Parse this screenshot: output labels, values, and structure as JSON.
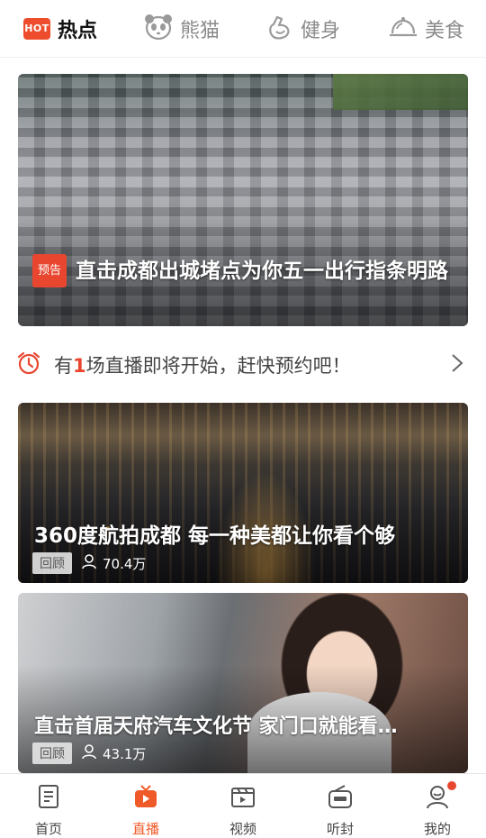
{
  "top_tabs": [
    {
      "label": "热点",
      "icon": "hot-badge",
      "badge_text": "HOT",
      "active": true
    },
    {
      "label": "熊猫",
      "icon": "panda-icon"
    },
    {
      "label": "健身",
      "icon": "fitness-icon"
    },
    {
      "label": "美食",
      "icon": "food-cloche-icon"
    }
  ],
  "feature_card": {
    "tag": "预告",
    "title": "直击成都出城堵点为你五一出行指条明路"
  },
  "notice": {
    "prefix": "有",
    "count": "1",
    "suffix": "场直播即将开始，赶快预约吧！"
  },
  "video_cards": [
    {
      "title": "360度航拍成都 每一种美都让你看个够",
      "tag": "回顾",
      "viewers": "70.4万"
    },
    {
      "title": "直击首届天府汽车文化节 家门口就能看…",
      "tag": "回顾",
      "viewers": "43.1万"
    }
  ],
  "bottom_nav": [
    {
      "label": "首页",
      "icon": "news-icon"
    },
    {
      "label": "直播",
      "icon": "live-tv-icon",
      "active": true
    },
    {
      "label": "视频",
      "icon": "video-icon"
    },
    {
      "label": "听封",
      "icon": "radio-icon"
    },
    {
      "label": "我的",
      "icon": "profile-icon",
      "has_dot": true
    }
  ],
  "colors": {
    "accent": "#E8462F",
    "active_nav": "#F05A28"
  }
}
